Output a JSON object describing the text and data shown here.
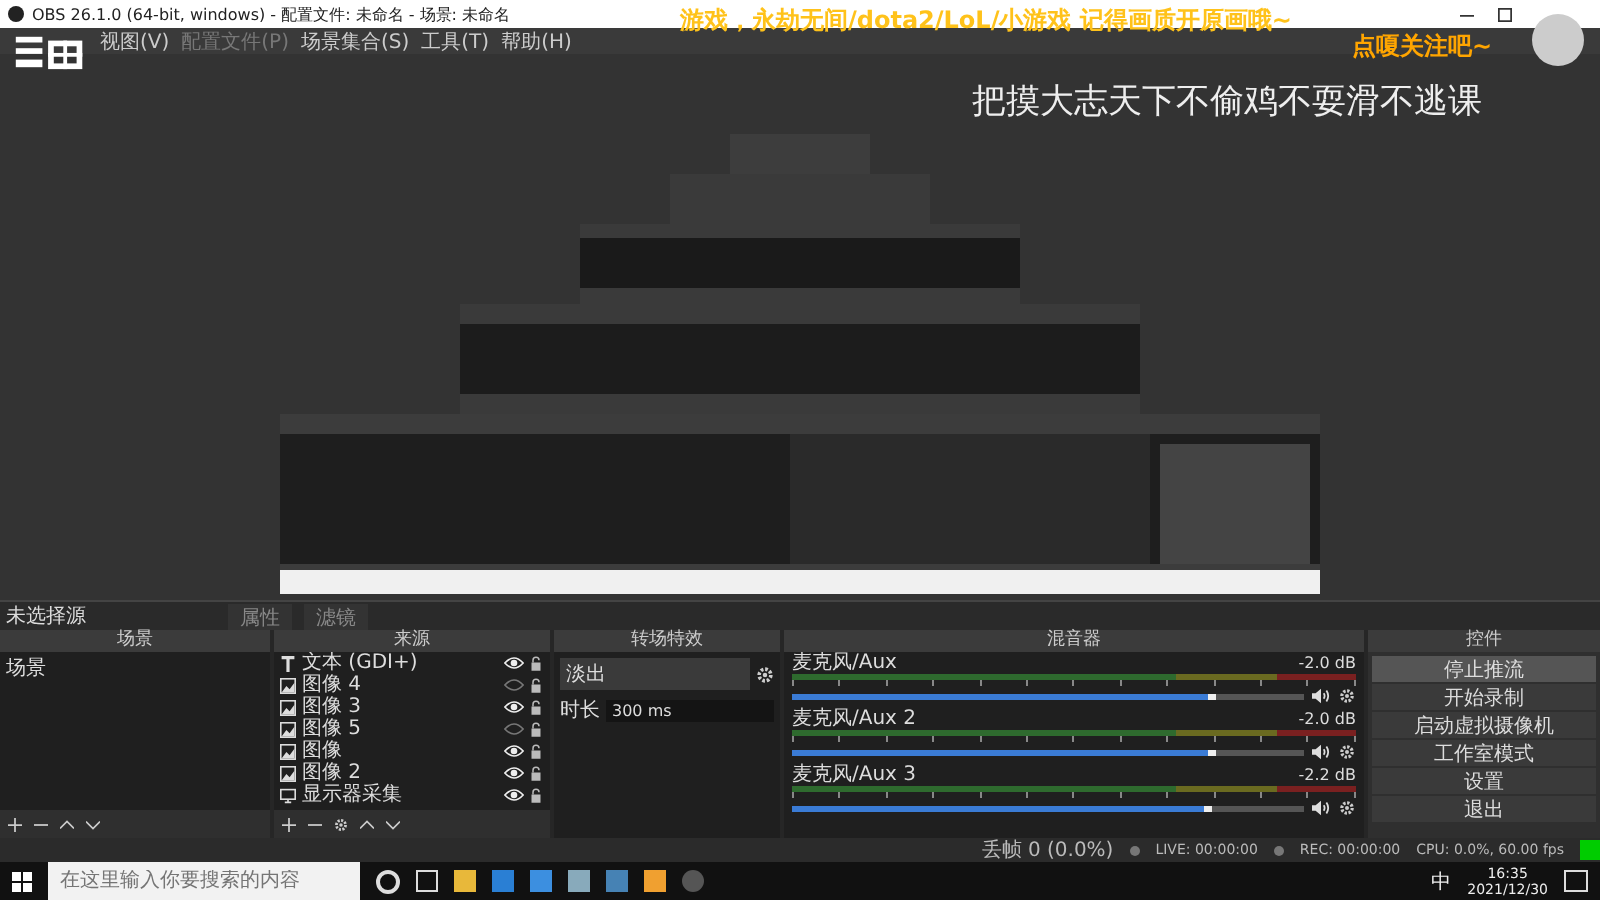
{
  "window": {
    "title": "OBS 26.1.0 (64-bit, windows) - 配置文件: 未命名 - 场景: 未命名"
  },
  "menu": [
    {
      "label": "视图(V)",
      "disabled": false
    },
    {
      "label": "配置文件(P)",
      "disabled": true
    },
    {
      "label": "场景集合(S)",
      "disabled": false
    },
    {
      "label": "工具(T)",
      "disabled": false
    },
    {
      "label": "帮助(H)",
      "disabled": false
    }
  ],
  "overlay": {
    "banner": "游戏，永劫无间/dota2/LoL/小游戏  记得画质开原画哦~",
    "follow": "点嗄关注吧~",
    "slogan": "把摸大志天下不偷鸡不耍滑不逃课"
  },
  "source_bar": {
    "label": "未选择源",
    "buttons": [
      {
        "label": "属性",
        "disabled": true
      },
      {
        "label": "滤镜",
        "disabled": true
      }
    ]
  },
  "scenes": {
    "title": "场景",
    "items": [
      {
        "label": "场景",
        "selected": false
      }
    ]
  },
  "sources": {
    "title": "来源",
    "items": [
      {
        "kind": "text",
        "label": "文本 (GDI+)",
        "visible": true
      },
      {
        "kind": "image",
        "label": "图像 4",
        "visible": false
      },
      {
        "kind": "image",
        "label": "图像 3",
        "visible": true
      },
      {
        "kind": "image",
        "label": "图像 5",
        "visible": false
      },
      {
        "kind": "image",
        "label": "图像",
        "visible": true
      },
      {
        "kind": "image",
        "label": "图像 2",
        "visible": true
      },
      {
        "kind": "display",
        "label": "显示器采集",
        "visible": true
      }
    ]
  },
  "transitions": {
    "title": "转场特效",
    "selected": "淡出",
    "duration_label": "时长",
    "duration": "300 ms"
  },
  "mixer": {
    "title": "混音器",
    "channels": [
      {
        "name": "麦克风/Aux",
        "reading": "-2.0 dB",
        "level": 0.83
      },
      {
        "name": "麦克风/Aux 2",
        "reading": "-2.0 dB",
        "level": 0.83
      },
      {
        "name": "麦克风/Aux 3",
        "reading": "-2.2 dB",
        "level": 0.82
      }
    ]
  },
  "controls": {
    "title": "控件",
    "buttons": [
      {
        "label": "停止推流",
        "selected": true
      },
      {
        "label": "开始录制",
        "selected": false
      },
      {
        "label": "启动虚拟摄像机",
        "selected": false
      },
      {
        "label": "工作室模式",
        "selected": false
      },
      {
        "label": "设置",
        "selected": false
      },
      {
        "label": "退出",
        "selected": false
      }
    ]
  },
  "status_bar": {
    "dropped": "丢帧 0 (0.0%)",
    "live": "LIVE: 00:00:00",
    "rec": "REC: 00:00:00",
    "cpu": "CPU: 0.0%, 60.00 fps"
  },
  "taskbar": {
    "search_placeholder": "在这里输入你要搜索的内容",
    "ime": "中",
    "time": "16:35",
    "date": "2021/12/30"
  }
}
